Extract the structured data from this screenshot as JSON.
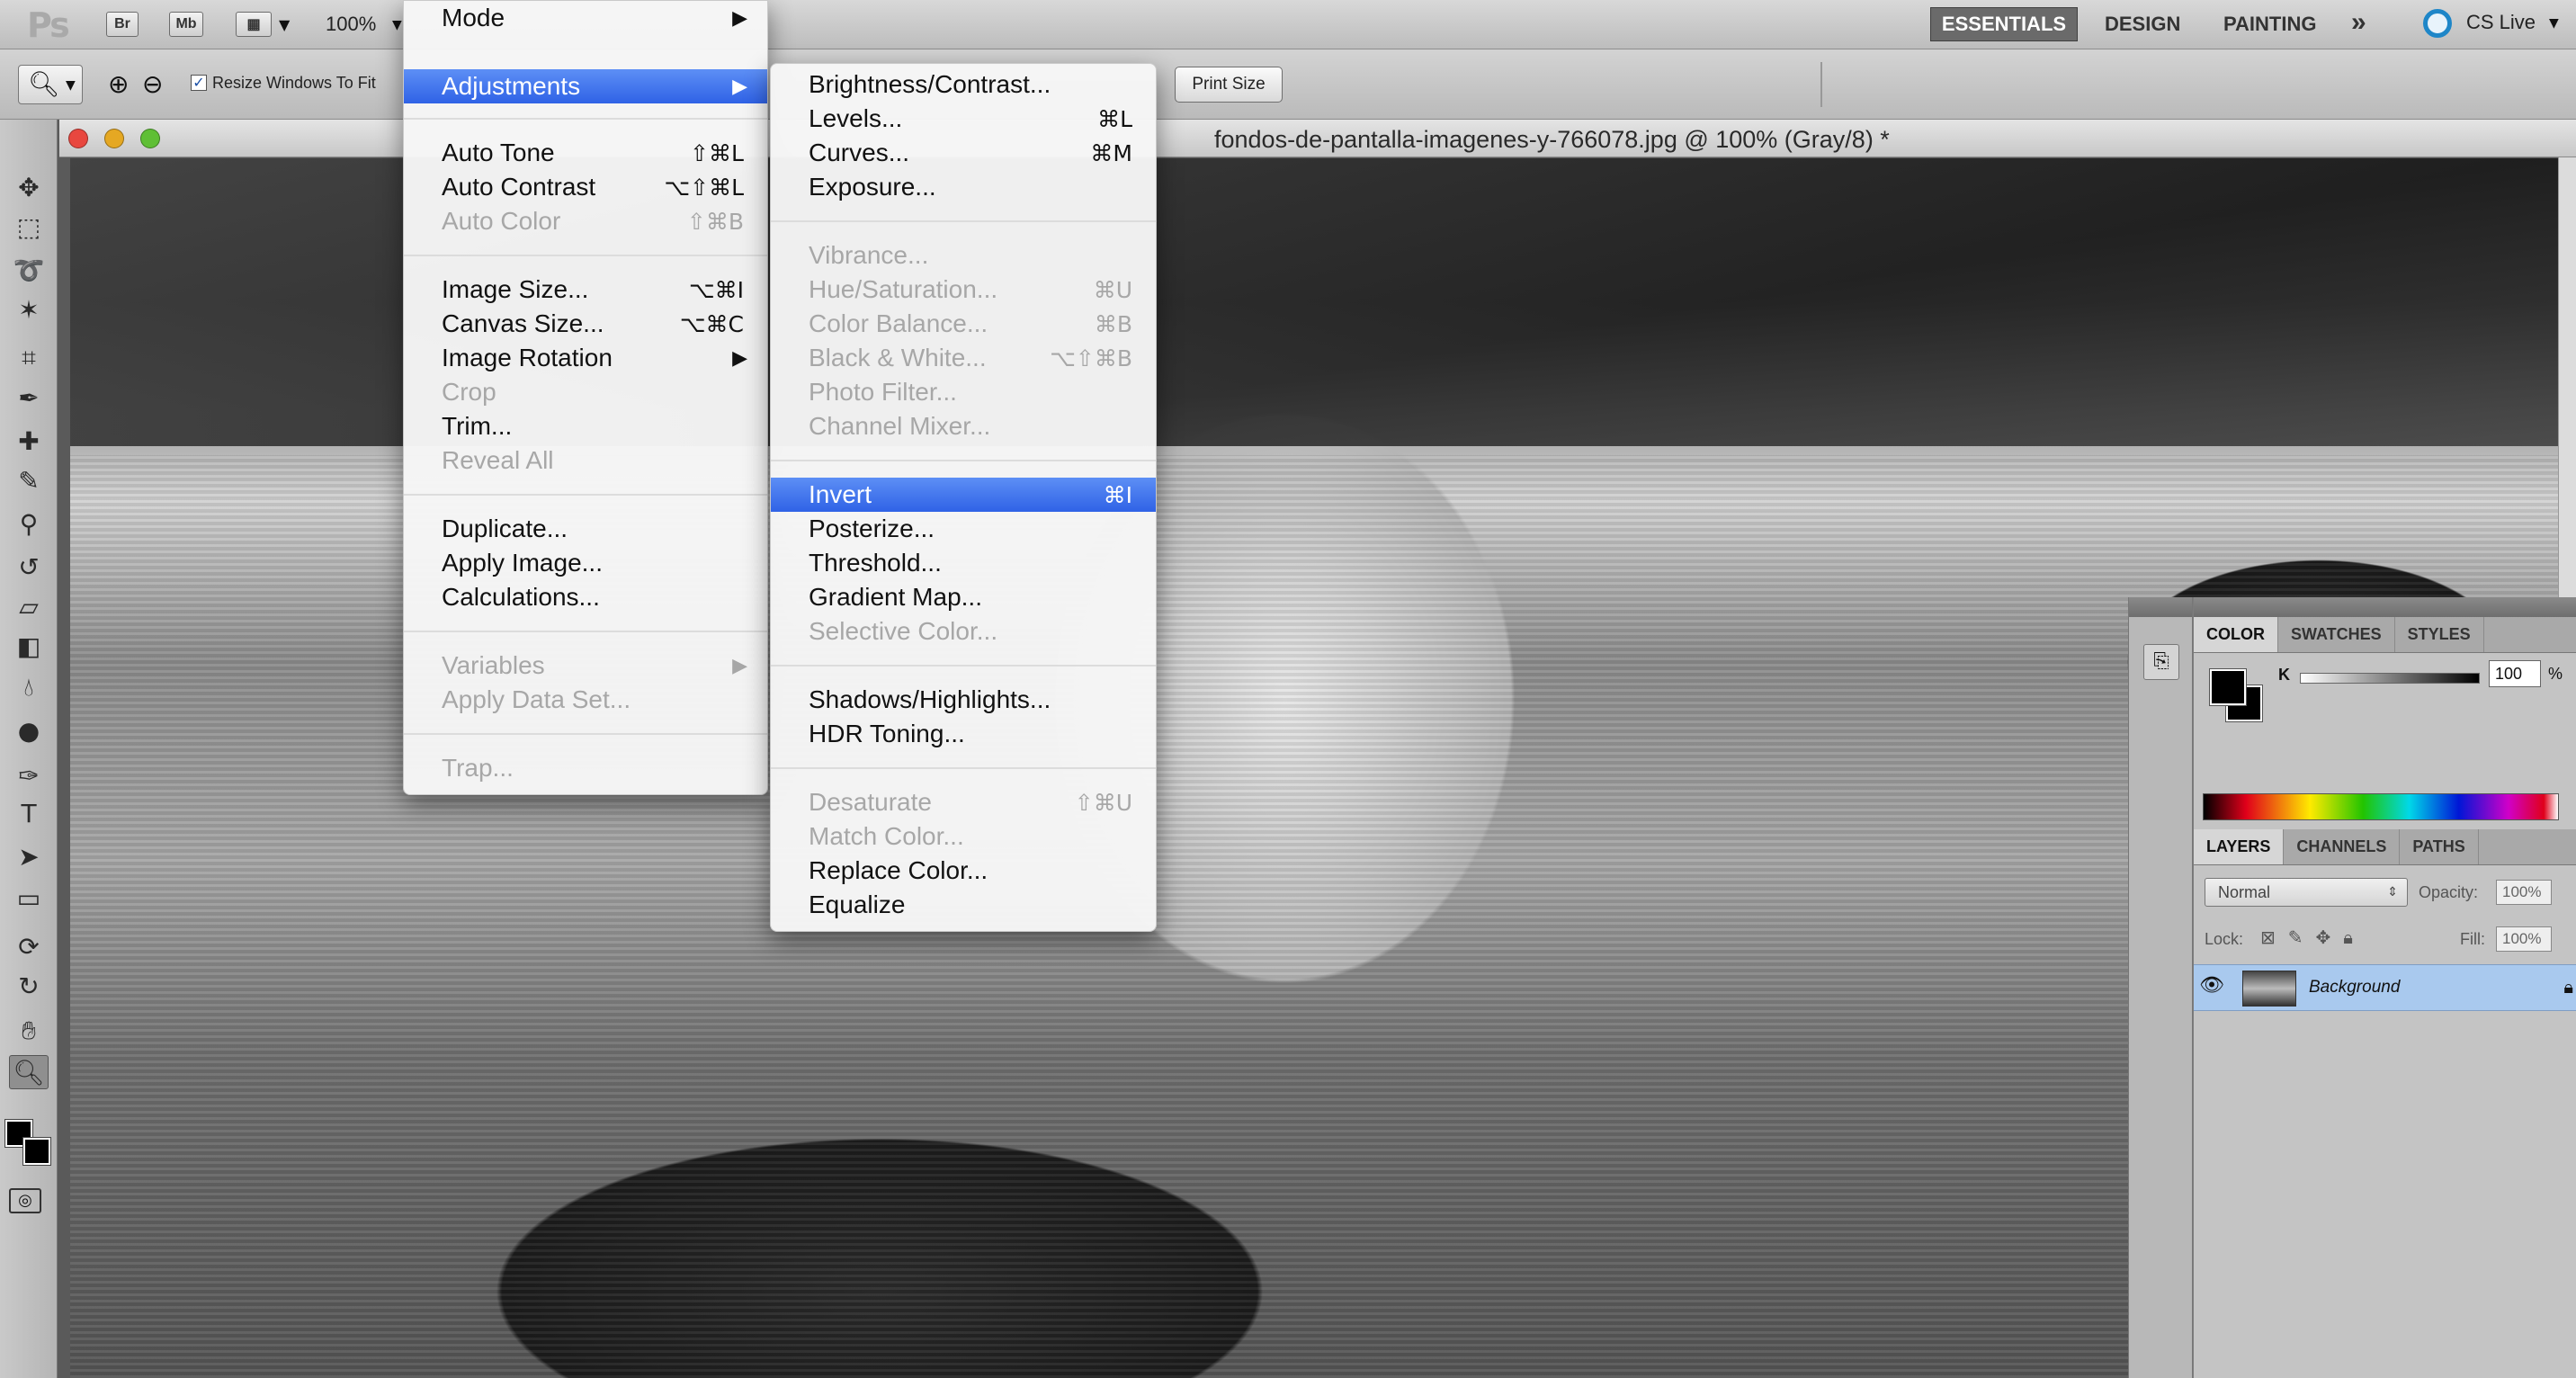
{
  "app_bar": {
    "logo": "Ps",
    "buttons": [
      "Br",
      "Mb"
    ],
    "zoom": "100%",
    "workspaces": {
      "active": "ESSENTIALS",
      "others": [
        "DESIGN",
        "PAINTING"
      ],
      "more": "»"
    },
    "cs_live": "CS Live"
  },
  "options_bar": {
    "resize_label": "Resize Windows To Fit",
    "resize_checked": "✓",
    "print_size": "Print Size"
  },
  "tools": [
    "move-tool",
    "marquee-tool",
    "lasso-tool",
    "quick-select-tool",
    "crop-tool",
    "eyedropper-tool",
    "healing-brush-tool",
    "brush-tool",
    "clone-stamp-tool",
    "history-brush-tool",
    "eraser-tool",
    "gradient-tool",
    "blur-tool",
    "dodge-tool",
    "pen-tool",
    "type-tool",
    "path-select-tool",
    "shape-tool",
    "3d-rotate-tool",
    "3d-orbit-tool",
    "hand-tool",
    "zoom-tool"
  ],
  "document": {
    "title": "fondos-de-pantalla-imagenes-y-766078.jpg @ 100% (Gray/8) *"
  },
  "image_menu": {
    "items": [
      {
        "label": "Mode",
        "shortcut": "",
        "submenu": true,
        "disabled": false
      },
      {
        "label": "Adjustments",
        "shortcut": "",
        "submenu": true,
        "disabled": false,
        "highlighted": true
      },
      {
        "label": "Auto Tone",
        "shortcut": "⇧⌘L",
        "disabled": false
      },
      {
        "label": "Auto Contrast",
        "shortcut": "⌥⇧⌘L",
        "disabled": false
      },
      {
        "label": "Auto Color",
        "shortcut": "⇧⌘B",
        "disabled": true
      },
      {
        "label": "Image Size...",
        "shortcut": "⌥⌘I",
        "disabled": false
      },
      {
        "label": "Canvas Size...",
        "shortcut": "⌥⌘C",
        "disabled": false
      },
      {
        "label": "Image Rotation",
        "shortcut": "",
        "submenu": true,
        "disabled": false
      },
      {
        "label": "Crop",
        "shortcut": "",
        "disabled": true
      },
      {
        "label": "Trim...",
        "shortcut": "",
        "disabled": false
      },
      {
        "label": "Reveal All",
        "shortcut": "",
        "disabled": true
      },
      {
        "label": "Duplicate...",
        "shortcut": "",
        "disabled": false
      },
      {
        "label": "Apply Image...",
        "shortcut": "",
        "disabled": false
      },
      {
        "label": "Calculations...",
        "shortcut": "",
        "disabled": false
      },
      {
        "label": "Variables",
        "shortcut": "",
        "submenu": true,
        "disabled": true
      },
      {
        "label": "Apply Data Set...",
        "shortcut": "",
        "disabled": true
      },
      {
        "label": "Trap...",
        "shortcut": "",
        "disabled": true
      }
    ]
  },
  "adjustments_menu": {
    "items": [
      {
        "label": "Brightness/Contrast...",
        "shortcut": "",
        "disabled": false
      },
      {
        "label": "Levels...",
        "shortcut": "⌘L",
        "disabled": false
      },
      {
        "label": "Curves...",
        "shortcut": "⌘M",
        "disabled": false
      },
      {
        "label": "Exposure...",
        "shortcut": "",
        "disabled": false
      },
      {
        "label": "Vibrance...",
        "shortcut": "",
        "disabled": true
      },
      {
        "label": "Hue/Saturation...",
        "shortcut": "⌘U",
        "disabled": true
      },
      {
        "label": "Color Balance...",
        "shortcut": "⌘B",
        "disabled": true
      },
      {
        "label": "Black & White...",
        "shortcut": "⌥⇧⌘B",
        "disabled": true
      },
      {
        "label": "Photo Filter...",
        "shortcut": "",
        "disabled": true
      },
      {
        "label": "Channel Mixer...",
        "shortcut": "",
        "disabled": true
      },
      {
        "label": "Invert",
        "shortcut": "⌘I",
        "disabled": false,
        "highlighted": true
      },
      {
        "label": "Posterize...",
        "shortcut": "",
        "disabled": false
      },
      {
        "label": "Threshold...",
        "shortcut": "",
        "disabled": false
      },
      {
        "label": "Gradient Map...",
        "shortcut": "",
        "disabled": false
      },
      {
        "label": "Selective Color...",
        "shortcut": "",
        "disabled": true
      },
      {
        "label": "Shadows/Highlights...",
        "shortcut": "",
        "disabled": false
      },
      {
        "label": "HDR Toning...",
        "shortcut": "",
        "disabled": false
      },
      {
        "label": "Desaturate",
        "shortcut": "⇧⌘U",
        "disabled": true
      },
      {
        "label": "Match Color...",
        "shortcut": "",
        "disabled": true
      },
      {
        "label": "Replace Color...",
        "shortcut": "",
        "disabled": false
      },
      {
        "label": "Equalize",
        "shortcut": "",
        "disabled": false
      }
    ]
  },
  "color_panel": {
    "tabs": [
      "COLOR",
      "SWATCHES",
      "STYLES"
    ],
    "active_tab": "COLOR",
    "k_label": "K",
    "k_value": "100",
    "k_unit": "%",
    "foreground": "#000000",
    "background": "#000000"
  },
  "layers_panel": {
    "tabs": [
      "LAYERS",
      "CHANNELS",
      "PATHS"
    ],
    "active_tab": "LAYERS",
    "blend_mode": "Normal",
    "opacity_label": "Opacity:",
    "opacity_value": "100%",
    "lock_label": "Lock:",
    "fill_label": "Fill:",
    "fill_value": "100%",
    "layers": [
      {
        "name": "Background",
        "visible": true,
        "locked": true
      }
    ]
  },
  "colors": {
    "menu_highlight": "#3a6ff0",
    "active_layer": "#a9c9ee"
  }
}
